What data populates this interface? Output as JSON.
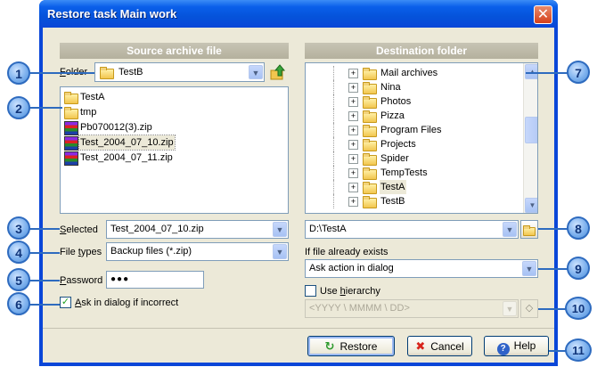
{
  "window": {
    "title": "Restore task Main work",
    "close_glyph": "✕"
  },
  "source": {
    "header": "Source archive file",
    "folder_label_prefix": "F",
    "folder_label_rest": "older",
    "folder_value": "TestB",
    "up_icon": "up-folder-icon",
    "files": [
      {
        "name": "TestA",
        "kind": "folder"
      },
      {
        "name": "tmp",
        "kind": "folder"
      },
      {
        "name": "Pb070012(3).zip",
        "kind": "zip"
      },
      {
        "name": "Test_2004_07_10.zip",
        "kind": "zip",
        "selected": true
      },
      {
        "name": "Test_2004_07_11.zip",
        "kind": "zip"
      }
    ],
    "selected_label_prefix": "S",
    "selected_label_rest": "elected",
    "selected_value": "Test_2004_07_10.zip",
    "filetypes_label_a": "File ",
    "filetypes_label_u": "t",
    "filetypes_label_b": "ypes",
    "filetypes_value": "Backup files (*.zip)",
    "password_label_prefix": "P",
    "password_label_rest": "assword",
    "password_value": "●●●",
    "ask_label_prefix": "A",
    "ask_label_rest": "sk in dialog if incorrect",
    "ask_checked": true
  },
  "destination": {
    "header": "Destination folder",
    "tree": [
      {
        "name": "Mail archives"
      },
      {
        "name": "Nina"
      },
      {
        "name": "Photos"
      },
      {
        "name": "Pizza"
      },
      {
        "name": "Program Files"
      },
      {
        "name": "Projects"
      },
      {
        "name": "Spider"
      },
      {
        "name": "TempTests"
      },
      {
        "name": "TestA",
        "selected": true
      },
      {
        "name": "TestB"
      }
    ],
    "path_value": "D:\\TestA",
    "exists_label": "If file already exists",
    "exists_value": "Ask action in dialog",
    "hierarchy_label_a": "Use ",
    "hierarchy_label_u": "h",
    "hierarchy_label_b": "ierarchy",
    "hierarchy_checked": false,
    "hierarchy_value": "<YYYY \\ MMMM \\ DD>"
  },
  "buttons": {
    "restore": "Restore",
    "cancel": "Cancel",
    "help": "Help"
  },
  "callouts": [
    "1",
    "2",
    "3",
    "4",
    "5",
    "6",
    "7",
    "8",
    "9",
    "10",
    "11"
  ]
}
